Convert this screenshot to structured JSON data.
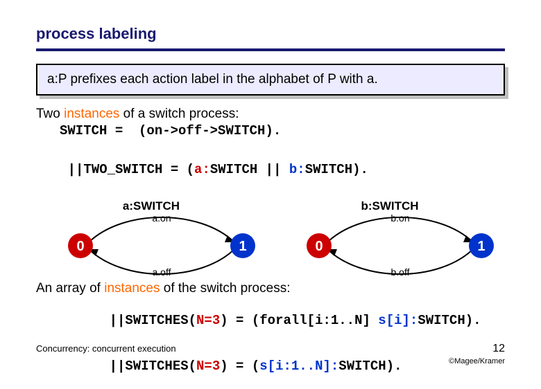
{
  "title": "process labeling",
  "definition": "a:P prefixes each action label in the alphabet of P with a.",
  "line_two_instances_pre": "Two ",
  "line_two_instances_em": "instances",
  "line_two_instances_post": " of a switch process:",
  "code_switch": "SWITCH =  (on->off->SWITCH).",
  "code_two_switch_pre": "||TWO_SWITCH = (",
  "code_two_switch_a": "a:",
  "code_two_switch_mid1": "SWITCH || ",
  "code_two_switch_b": "b:",
  "code_two_switch_mid2": "SWITCH).",
  "lts_a": {
    "title": "a:SWITCH",
    "on": "a.on",
    "off": "a.off",
    "s0": "0",
    "s1": "1"
  },
  "lts_b": {
    "title": "b:SWITCH",
    "on": "b.on",
    "off": "b.off",
    "s0": "0",
    "s1": "1"
  },
  "line_array_pre": "An array of ",
  "line_array_em": "instances",
  "line_array_post": " of the switch process:",
  "code_sw1_a": "||SWITCHES(",
  "code_sw1_n": "N=3",
  "code_sw1_b": ") = (forall[i:1..N] ",
  "code_sw1_c": "s[i]:",
  "code_sw1_d": "SWITCH).",
  "code_sw2_a": "||SWITCHES(",
  "code_sw2_n": "N=3",
  "code_sw2_b": ") = (",
  "code_sw2_c": "s[i:1..N]:",
  "code_sw2_d": "SWITCH).",
  "footer_left": "Concurrency: concurrent execution",
  "page_number": "12",
  "copyright": "©Magee/Kramer"
}
